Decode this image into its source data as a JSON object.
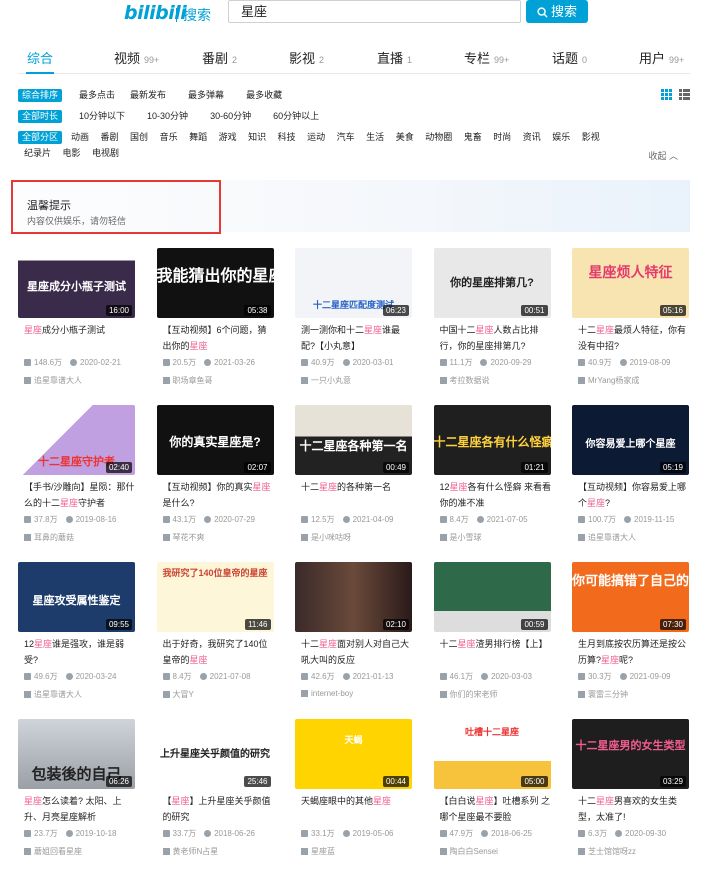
{
  "header": {
    "logo": "bilibili",
    "logo_sub": "搜索",
    "query": "星座",
    "search_button": "搜索"
  },
  "tabs": [
    {
      "label": "综合",
      "count": ""
    },
    {
      "label": "视频",
      "count": "99+"
    },
    {
      "label": "番剧",
      "count": "2"
    },
    {
      "label": "影视",
      "count": "2"
    },
    {
      "label": "直播",
      "count": "1"
    },
    {
      "label": "专栏",
      "count": "99+"
    },
    {
      "label": "话题",
      "count": "0"
    },
    {
      "label": "用户",
      "count": "99+"
    }
  ],
  "filters": {
    "order": {
      "selected": "综合排序",
      "options": [
        "最多点击",
        "最新发布",
        "最多弹幕",
        "最多收藏"
      ]
    },
    "duration": {
      "selected": "全部时长",
      "options": [
        "10分钟以下",
        "10-30分钟",
        "30-60分钟",
        "60分钟以上"
      ]
    },
    "zone": {
      "selected": "全部分区",
      "options_row1": [
        "动画",
        "番剧",
        "国创",
        "音乐",
        "舞蹈",
        "游戏",
        "知识",
        "科技",
        "运动",
        "汽车",
        "生活",
        "美食",
        "动物圈",
        "鬼畜",
        "时尚",
        "资讯",
        "娱乐",
        "影视"
      ],
      "options_row2": [
        "纪录片",
        "电影",
        "电视剧"
      ]
    },
    "collapse": "收起"
  },
  "notice": {
    "title": "温馨提示",
    "text": "内容仅供娱乐，请勿轻信"
  },
  "accent": "#00a1d6",
  "highlight": "#f25d8e",
  "videos": [
    {
      "title_pre": "",
      "title_hl": "星座",
      "title_post": "成分小瓶子测试",
      "views": "148.6万",
      "date": "2020-02-21",
      "uploader": "追星靠谱大人",
      "duration": "16:00",
      "cover": "星座成分小瓶子测试"
    },
    {
      "title_pre": "【互动视频】6个问题，猜出你的",
      "title_hl": "星座",
      "title_post": "",
      "views": "20.5万",
      "date": "2021-03-26",
      "uploader": "职场章鱼哥",
      "duration": "05:38",
      "cover": "我能猜出你的星座"
    },
    {
      "title_pre": "测一测你和十二",
      "title_hl": "星座",
      "title_post": "谁最配?【小丸意】",
      "views": "40.9万",
      "date": "2020-03-01",
      "uploader": "一只小丸意",
      "duration": "06:23",
      "cover": "十二星座匹配度测试"
    },
    {
      "title_pre": "中国十二",
      "title_hl": "星座",
      "title_post": "人数占比排行，你的星座排第几?",
      "views": "11.1万",
      "date": "2020-09-29",
      "uploader": "考拉数据说",
      "duration": "00:51",
      "cover": "你的星座排第几?"
    },
    {
      "title_pre": "十二",
      "title_hl": "星座",
      "title_post": "最烦人特征，你有没有中招?",
      "views": "40.9万",
      "date": "2019-08-09",
      "uploader": "MrYang杨家成",
      "duration": "05:16",
      "cover": "星座烦人特征"
    },
    {
      "title_pre": "【手书/沙雕向】星陨：那什么的十二",
      "title_hl": "星座",
      "title_post": "守护者",
      "views": "37.8万",
      "date": "2019-08-16",
      "uploader": "耳鼻的蘑菇",
      "duration": "02:40",
      "cover": "十二星座守护者"
    },
    {
      "title_pre": "【互动视频】你的真实",
      "title_hl": "星座",
      "title_post": "是什么?",
      "views": "43.1万",
      "date": "2020-07-29",
      "uploader": "琴花不爽",
      "duration": "02:07",
      "cover": "你的真实星座是?"
    },
    {
      "title_pre": "十二",
      "title_hl": "星座",
      "title_post": "的各种第一名",
      "views": "12.5万",
      "date": "2021-04-09",
      "uploader": "是小咪咕呀",
      "duration": "00:49",
      "cover": "十二星座各种第一名"
    },
    {
      "title_pre": "12",
      "title_hl": "星座",
      "title_post": "各有什么怪癖 来看看你的准不准",
      "views": "8.4万",
      "date": "2021-07-05",
      "uploader": "是小雪球",
      "duration": "01:21",
      "cover": "十二星座各有什么怪癖"
    },
    {
      "title_pre": "【互动视频】你容易爱上哪个",
      "title_hl": "星座",
      "title_post": "?",
      "views": "100.7万",
      "date": "2019-11-15",
      "uploader": "追星靠谱大人",
      "duration": "05:19",
      "cover": "你容易爱上哪个星座"
    },
    {
      "title_pre": "12",
      "title_hl": "星座",
      "title_post": "谁是强攻，谁是弱受?",
      "views": "49.6万",
      "date": "2020-03-24",
      "uploader": "追星靠谱大人",
      "duration": "09:55",
      "cover": "星座攻受属性鉴定"
    },
    {
      "title_pre": "出于好奇，我研究了140位皇帝的",
      "title_hl": "星座",
      "title_post": "",
      "views": "8.4万",
      "date": "2021-07-08",
      "uploader": "大冒Y",
      "duration": "11:46",
      "cover": "我研究了140位皇帝的星座"
    },
    {
      "title_pre": "十二",
      "title_hl": "星座",
      "title_post": "面对别人对自己大吼大叫的反应",
      "views": "42.6万",
      "date": "2021-01-13",
      "uploader": "internet-boy",
      "duration": "02:10",
      "cover": ""
    },
    {
      "title_pre": "十二",
      "title_hl": "星座",
      "title_post": "渣男排行榜【上】",
      "views": "46.1万",
      "date": "2020-03-03",
      "uploader": "你们的宋老师",
      "duration": "00:59",
      "cover": ""
    },
    {
      "title_pre": "生月到底按农历算还是按公历算?",
      "title_hl": "星座",
      "title_post": "呢?",
      "views": "30.3万",
      "date": "2021-09-09",
      "uploader": "寰雷三分钟",
      "duration": "07:30",
      "cover": "你可能搞错了自己的生日"
    },
    {
      "title_pre": "",
      "title_hl": "星座",
      "title_post": "怎么读着? 太阳、上升、月亮星座解析",
      "views": "23.7万",
      "date": "2019-10-18",
      "uploader": "蘑姐回看星座",
      "duration": "06:26",
      "cover": "包装後的自己"
    },
    {
      "title_pre": "【",
      "title_hl": "星座",
      "title_post": "】上升星座关乎颜值的研究",
      "views": "33.7万",
      "date": "2018-06-26",
      "uploader": "黄老师N占星",
      "duration": "25:46",
      "cover": "上升星座关乎颜值的研究"
    },
    {
      "title_pre": "天蝎座眼中的其他",
      "title_hl": "星座",
      "title_post": "",
      "views": "33.1万",
      "date": "2019-05-06",
      "uploader": "星座蓝",
      "duration": "00:44",
      "cover": "天蝎"
    },
    {
      "title_pre": "【白白说",
      "title_hl": "星座",
      "title_post": "】吐槽系列 之 哪个星座最不要脸",
      "views": "47.9万",
      "date": "2018-06-25",
      "uploader": "陶白白Sensei",
      "duration": "05:00",
      "cover": "吐槽十二星座"
    },
    {
      "title_pre": "十二",
      "title_hl": "星座",
      "title_post": "男喜欢的女生类型，太准了!",
      "views": "6.3万",
      "date": "2020-09-30",
      "uploader": "芝士馆馆呀zz",
      "duration": "03:29",
      "cover": "十二星座男的女生类型"
    }
  ]
}
